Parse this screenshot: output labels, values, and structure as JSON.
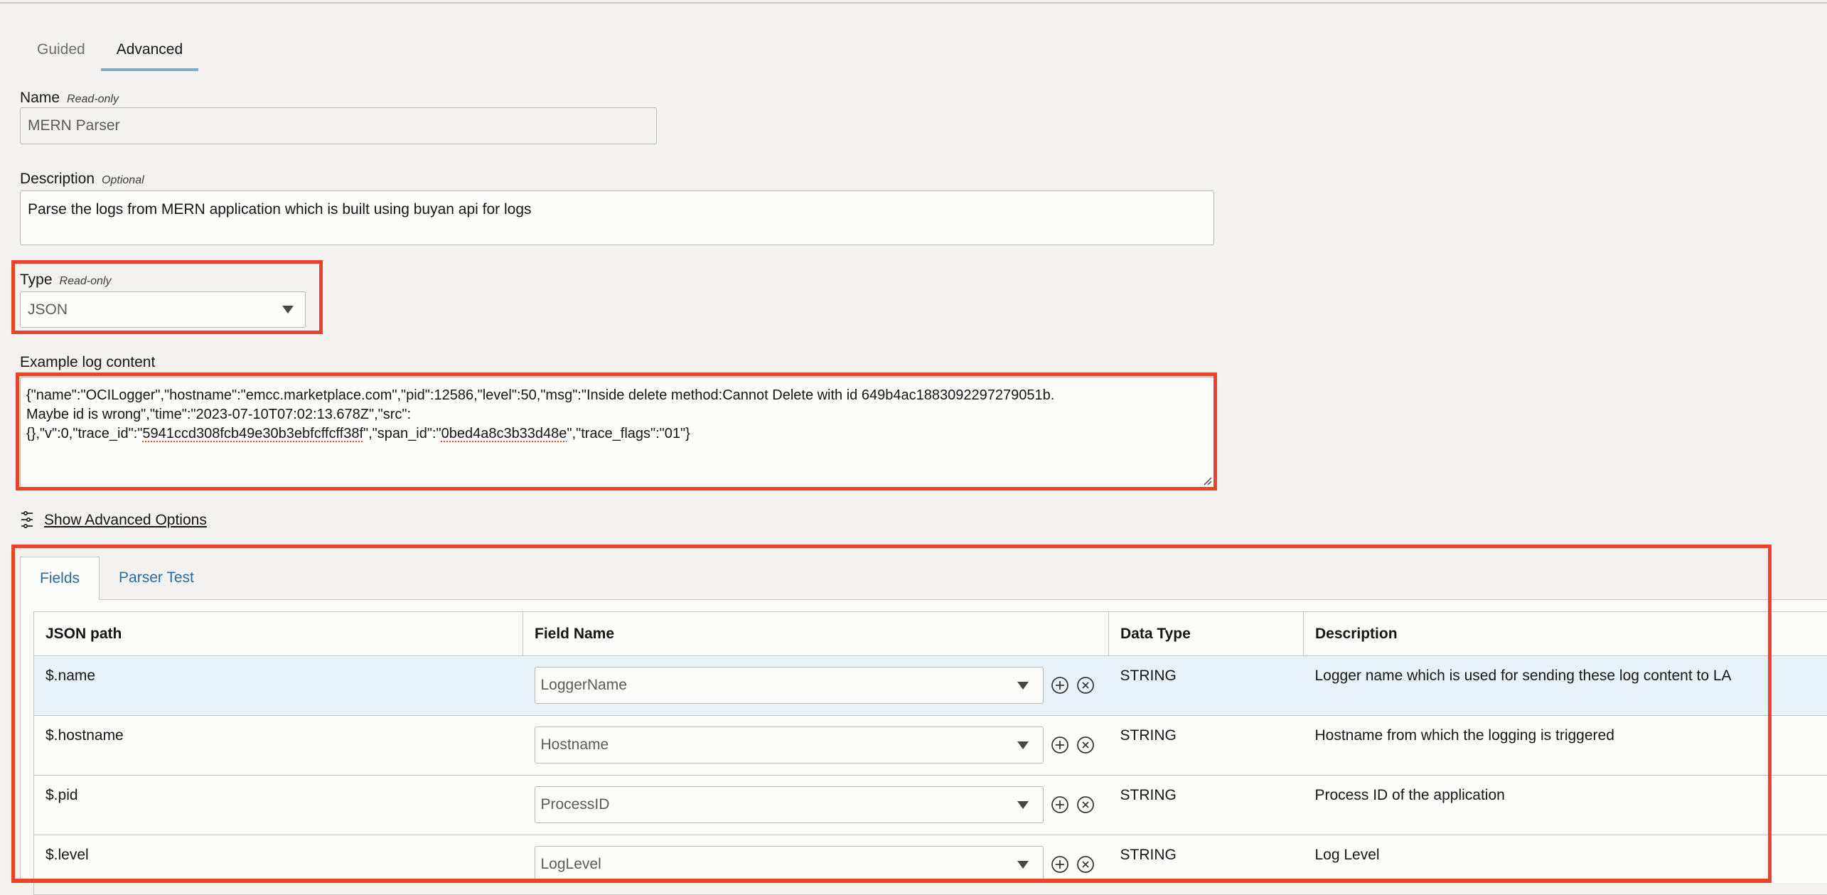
{
  "mode_tabs": [
    {
      "label": "Guided",
      "active": false
    },
    {
      "label": "Advanced",
      "active": true
    }
  ],
  "name": {
    "label": "Name",
    "hint": "Read-only",
    "value": "MERN Parser"
  },
  "description": {
    "label": "Description",
    "hint": "Optional",
    "value": "Parse the logs from MERN application which is built using buyan api for logs"
  },
  "type": {
    "label": "Type",
    "hint": "Read-only",
    "value": "JSON"
  },
  "example_log": {
    "label": "Example log content",
    "line1": "{\"name\":\"OCILogger\",\"hostname\":\"emcc.marketplace.com\",\"pid\":12586,\"level\":50,\"msg\":\"Inside delete method:Cannot Delete with id 649b4ac1883092297279051b.",
    "line2": "Maybe id is wrong\",\"time\":\"2023-07-10T07:02:13.678Z\",\"src\":",
    "line3_pre": "{},\"v\":0,\"trace_id\":\"",
    "trace_id": "5941ccd308fcb49e30b3ebfcffcff38f",
    "line3_mid": "\",\"span_id\":\"",
    "span_id": "0bed4a8c3b33d48e",
    "line3_post": "\",\"trace_flags\":\"01\"}"
  },
  "advanced_options": {
    "label": "Show Advanced Options",
    "icon": "sliders-icon"
  },
  "panel_tabs": [
    {
      "label": "Fields",
      "active": true
    },
    {
      "label": "Parser Test",
      "active": false
    }
  ],
  "table": {
    "columns": [
      "JSON path",
      "Field Name",
      "Data Type",
      "Description"
    ],
    "rows": [
      {
        "path": "$.name",
        "field": "LoggerName",
        "type": "STRING",
        "description": "Logger name which is used for sending these log content to LA",
        "selected": true
      },
      {
        "path": "$.hostname",
        "field": "Hostname",
        "type": "STRING",
        "description": "Hostname from which the logging is triggered",
        "selected": false
      },
      {
        "path": "$.pid",
        "field": "ProcessID",
        "type": "STRING",
        "description": "Process ID of the application",
        "selected": false
      },
      {
        "path": "$.level",
        "field": "LogLevel",
        "type": "STRING",
        "description": "Log Level",
        "selected": false
      }
    ]
  },
  "colors": {
    "highlight_box": "#e8442a",
    "active_tab_underline": "#7fa9c1",
    "link_blue": "#2c6aa0",
    "selected_row": "#eaf2f9",
    "background": "#f3f2f0"
  }
}
